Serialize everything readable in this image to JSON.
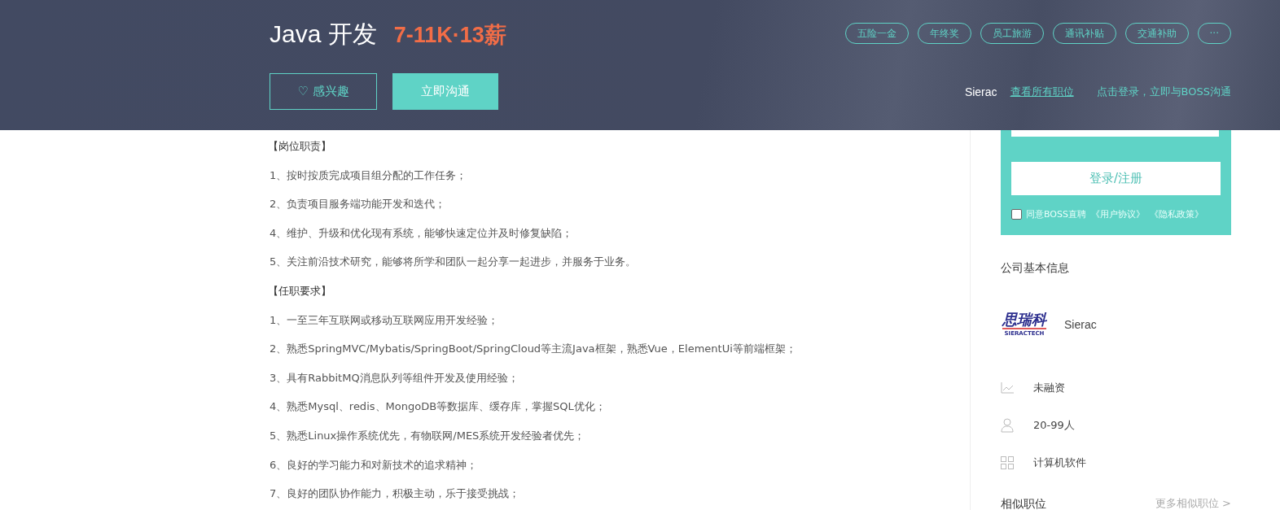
{
  "header": {
    "title": "Java 开发",
    "salary": "7-11K·13薪",
    "benefits": [
      "五险一金",
      "年终奖",
      "员工旅游",
      "通讯补贴",
      "交通补助",
      "···"
    ],
    "interest_button": {
      "icon": "♡",
      "label": "感兴趣"
    },
    "chat_button": "立即沟通",
    "company": "Sierac",
    "all_jobs_link": "查看所有职位",
    "login_link": "点击登录，立即与BOSS沟通"
  },
  "description": [
    {
      "kind": "heading",
      "text": "【岗位职责】"
    },
    {
      "kind": "item",
      "text": "1、按时按质完成项目组分配的工作任务；"
    },
    {
      "kind": "item",
      "text": "2、负责项目服务端功能开发和迭代；"
    },
    {
      "kind": "item",
      "text": "4、维护、升级和优化现有系统，能够快速定位并及时修复缺陷；"
    },
    {
      "kind": "item",
      "text": "5、关注前沿技术研究，能够将所学和团队一起分享一起进步，并服务于业务。"
    },
    {
      "kind": "heading",
      "text": "【任职要求】"
    },
    {
      "kind": "item",
      "text": "1、一至三年互联网或移动互联网应用开发经验；"
    },
    {
      "kind": "item",
      "text": "2、熟悉SpringMVC/Mybatis/SpringBoot/SpringCloud等主流Java框架，熟悉Vue，ElementUi等前端框架；"
    },
    {
      "kind": "item",
      "text": "3、具有RabbitMQ消息队列等组件开发及使用经验；"
    },
    {
      "kind": "item",
      "text": "4、熟悉Mysql、redis、MongoDB等数据库、缓存库，掌握SQL优化；"
    },
    {
      "kind": "item",
      "text": "5、熟悉Linux操作系统优先，有物联网/MES系统开发经验者优先；"
    },
    {
      "kind": "item",
      "text": "6、良好的学习能力和对新技术的追求精神；"
    },
    {
      "kind": "item",
      "text": "7、良好的团队协作能力，积极主动，乐于接受挑战；"
    }
  ],
  "login_card": {
    "button": "登录/注册",
    "agree": {
      "checked": false,
      "text": "同意BOSS直聘",
      "links": [
        "《用户协议》",
        "《隐私政策》"
      ]
    }
  },
  "company_info": {
    "title": "公司基本信息",
    "logo": {
      "name": "思瑞科",
      "sub": "SIERACTECH"
    },
    "name": "Sierac",
    "facts": [
      {
        "kind": "funding",
        "text": "未融资"
      },
      {
        "kind": "size",
        "text": "20-99人"
      },
      {
        "kind": "industry",
        "text": "计算机软件"
      }
    ]
  },
  "similar": {
    "title": "相似职位",
    "more": "更多相似职位 >"
  }
}
